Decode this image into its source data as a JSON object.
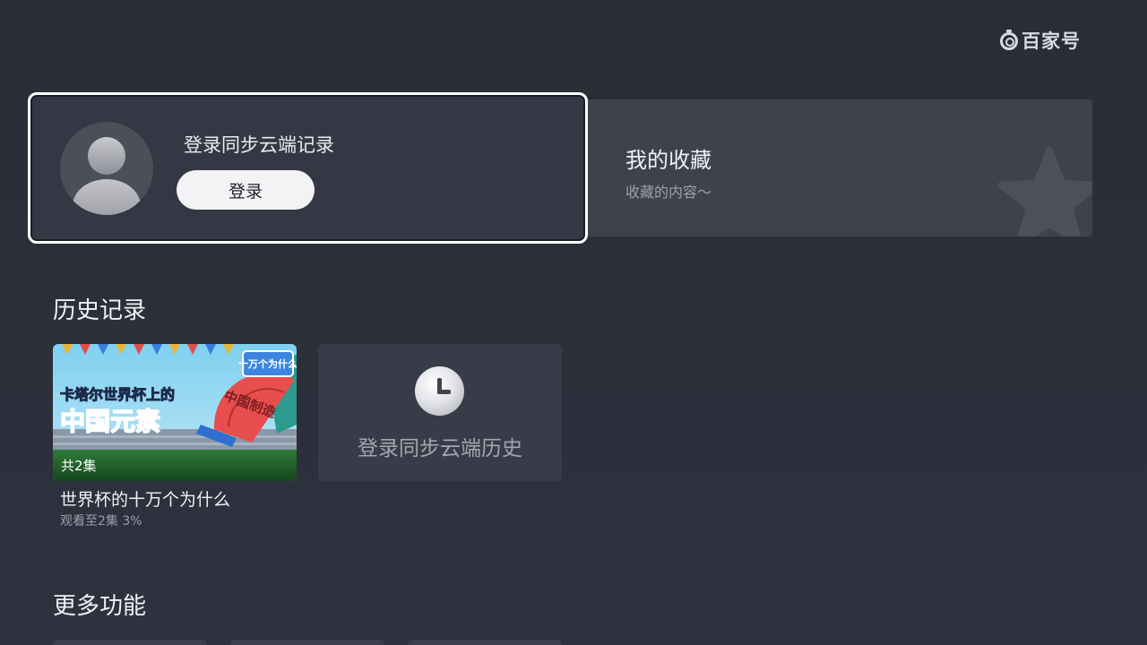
{
  "brand": {
    "name": "百家号"
  },
  "login": {
    "title": "登录同步云端记录",
    "button_label": "登录"
  },
  "favorites": {
    "title": "我的收藏",
    "subtitle": "收藏的内容～"
  },
  "history": {
    "section_title": "历史记录",
    "items": [
      {
        "name": "世界杯的十万个为什么",
        "episode_badge": "共2集",
        "progress_text": "观看至2集  3%",
        "thumbnail_text": {
          "line1": "卡塔尔世界杯上的",
          "line2": "中国元素",
          "fan": "中国制造",
          "corner": "十万个为什么"
        }
      }
    ],
    "sync_card": {
      "label": "登录同步云端历史",
      "icon": "clock-icon"
    }
  },
  "more": {
    "section_title": "更多功能"
  }
}
